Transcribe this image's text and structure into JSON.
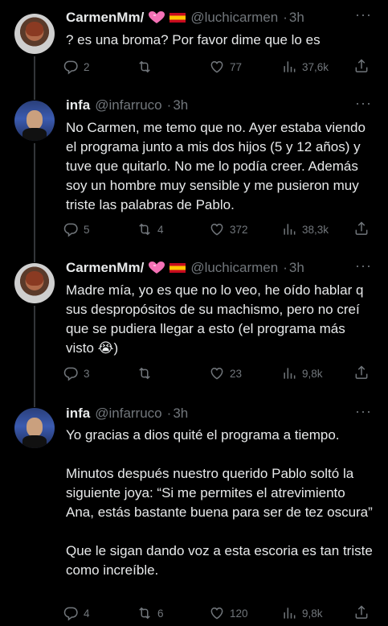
{
  "tweets": [
    {
      "author": "CarmenMm/",
      "handle": "@luchicarmen",
      "time": "3h",
      "text": "? es una broma? Por favor dime que lo es",
      "replies": "2",
      "retweets": "",
      "likes": "77",
      "views": "37,6k"
    },
    {
      "author": "infa",
      "handle": "@infarruco",
      "time": "3h",
      "text": "No Carmen, me temo que no. Ayer estaba viendo el programa junto a mis dos hijos (5 y 12 años) y tuve que quitarlo. No me lo podía creer. Además soy un hombre muy sensible y me pusieron muy triste las palabras de Pablo.",
      "replies": "5",
      "retweets": "4",
      "likes": "372",
      "views": "38,3k"
    },
    {
      "author": "CarmenMm/",
      "handle": "@luchicarmen",
      "time": "3h",
      "text": "Madre mía, yo es que no lo veo, he oído hablar q sus despropósitos de su machismo, pero no creí que se pudiera llegar a esto (el programa más visto 😭)",
      "replies": "3",
      "retweets": "",
      "likes": "23",
      "views": "9,8k"
    },
    {
      "author": "infa",
      "handle": "@infarruco",
      "time": "3h",
      "text": "Yo gracias a dios quité el programa a tiempo.\n\nMinutos después nuestro querido Pablo soltó la siguiente joya: “Si me permites el atrevimiento Ana, estás bastante buena para ser de tez oscura”\n\nQue le sigan dando voz a esta escoria es tan triste como increíble.",
      "replies": "4",
      "retweets": "6",
      "likes": "120",
      "views": "9,8k"
    }
  ],
  "icons": {
    "more": "more-dots-icon",
    "reply": "reply-icon",
    "retweet": "retweet-icon",
    "like": "heart-icon",
    "views": "views-chart-icon",
    "share": "share-icon",
    "heart_badge": "pink-heart-emoji",
    "flag_badge": "spain-flag-emoji"
  },
  "colors": {
    "background": "#000000",
    "text": "#e7e9ea",
    "muted": "#71767b",
    "thread_line": "#333639",
    "heart_badge": "#f472b6"
  }
}
